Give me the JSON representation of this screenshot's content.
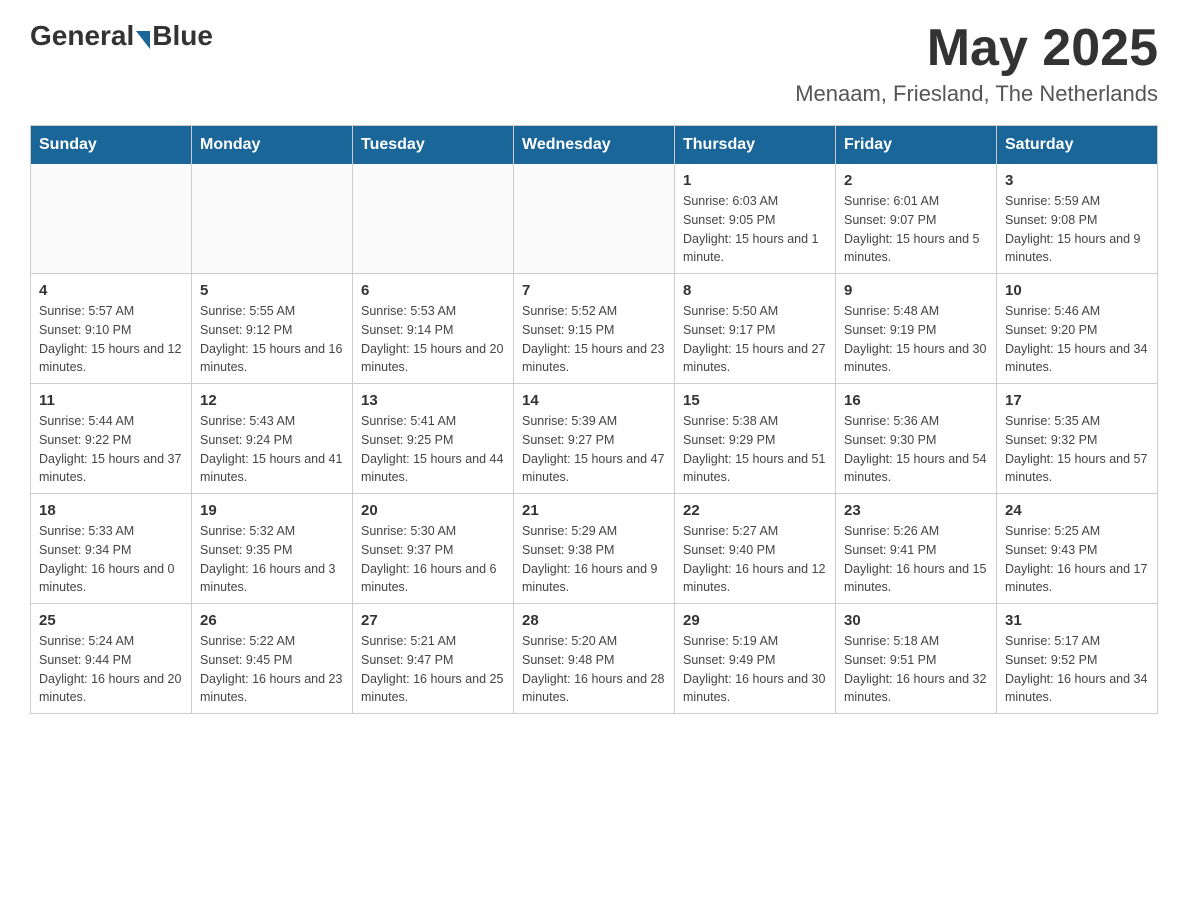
{
  "header": {
    "logo_general": "General",
    "logo_blue": "Blue",
    "month_year": "May 2025",
    "location": "Menaam, Friesland, The Netherlands"
  },
  "days_of_week": [
    "Sunday",
    "Monday",
    "Tuesday",
    "Wednesday",
    "Thursday",
    "Friday",
    "Saturday"
  ],
  "weeks": [
    [
      {
        "day": "",
        "info": ""
      },
      {
        "day": "",
        "info": ""
      },
      {
        "day": "",
        "info": ""
      },
      {
        "day": "",
        "info": ""
      },
      {
        "day": "1",
        "info": "Sunrise: 6:03 AM\nSunset: 9:05 PM\nDaylight: 15 hours and 1 minute."
      },
      {
        "day": "2",
        "info": "Sunrise: 6:01 AM\nSunset: 9:07 PM\nDaylight: 15 hours and 5 minutes."
      },
      {
        "day": "3",
        "info": "Sunrise: 5:59 AM\nSunset: 9:08 PM\nDaylight: 15 hours and 9 minutes."
      }
    ],
    [
      {
        "day": "4",
        "info": "Sunrise: 5:57 AM\nSunset: 9:10 PM\nDaylight: 15 hours and 12 minutes."
      },
      {
        "day": "5",
        "info": "Sunrise: 5:55 AM\nSunset: 9:12 PM\nDaylight: 15 hours and 16 minutes."
      },
      {
        "day": "6",
        "info": "Sunrise: 5:53 AM\nSunset: 9:14 PM\nDaylight: 15 hours and 20 minutes."
      },
      {
        "day": "7",
        "info": "Sunrise: 5:52 AM\nSunset: 9:15 PM\nDaylight: 15 hours and 23 minutes."
      },
      {
        "day": "8",
        "info": "Sunrise: 5:50 AM\nSunset: 9:17 PM\nDaylight: 15 hours and 27 minutes."
      },
      {
        "day": "9",
        "info": "Sunrise: 5:48 AM\nSunset: 9:19 PM\nDaylight: 15 hours and 30 minutes."
      },
      {
        "day": "10",
        "info": "Sunrise: 5:46 AM\nSunset: 9:20 PM\nDaylight: 15 hours and 34 minutes."
      }
    ],
    [
      {
        "day": "11",
        "info": "Sunrise: 5:44 AM\nSunset: 9:22 PM\nDaylight: 15 hours and 37 minutes."
      },
      {
        "day": "12",
        "info": "Sunrise: 5:43 AM\nSunset: 9:24 PM\nDaylight: 15 hours and 41 minutes."
      },
      {
        "day": "13",
        "info": "Sunrise: 5:41 AM\nSunset: 9:25 PM\nDaylight: 15 hours and 44 minutes."
      },
      {
        "day": "14",
        "info": "Sunrise: 5:39 AM\nSunset: 9:27 PM\nDaylight: 15 hours and 47 minutes."
      },
      {
        "day": "15",
        "info": "Sunrise: 5:38 AM\nSunset: 9:29 PM\nDaylight: 15 hours and 51 minutes."
      },
      {
        "day": "16",
        "info": "Sunrise: 5:36 AM\nSunset: 9:30 PM\nDaylight: 15 hours and 54 minutes."
      },
      {
        "day": "17",
        "info": "Sunrise: 5:35 AM\nSunset: 9:32 PM\nDaylight: 15 hours and 57 minutes."
      }
    ],
    [
      {
        "day": "18",
        "info": "Sunrise: 5:33 AM\nSunset: 9:34 PM\nDaylight: 16 hours and 0 minutes."
      },
      {
        "day": "19",
        "info": "Sunrise: 5:32 AM\nSunset: 9:35 PM\nDaylight: 16 hours and 3 minutes."
      },
      {
        "day": "20",
        "info": "Sunrise: 5:30 AM\nSunset: 9:37 PM\nDaylight: 16 hours and 6 minutes."
      },
      {
        "day": "21",
        "info": "Sunrise: 5:29 AM\nSunset: 9:38 PM\nDaylight: 16 hours and 9 minutes."
      },
      {
        "day": "22",
        "info": "Sunrise: 5:27 AM\nSunset: 9:40 PM\nDaylight: 16 hours and 12 minutes."
      },
      {
        "day": "23",
        "info": "Sunrise: 5:26 AM\nSunset: 9:41 PM\nDaylight: 16 hours and 15 minutes."
      },
      {
        "day": "24",
        "info": "Sunrise: 5:25 AM\nSunset: 9:43 PM\nDaylight: 16 hours and 17 minutes."
      }
    ],
    [
      {
        "day": "25",
        "info": "Sunrise: 5:24 AM\nSunset: 9:44 PM\nDaylight: 16 hours and 20 minutes."
      },
      {
        "day": "26",
        "info": "Sunrise: 5:22 AM\nSunset: 9:45 PM\nDaylight: 16 hours and 23 minutes."
      },
      {
        "day": "27",
        "info": "Sunrise: 5:21 AM\nSunset: 9:47 PM\nDaylight: 16 hours and 25 minutes."
      },
      {
        "day": "28",
        "info": "Sunrise: 5:20 AM\nSunset: 9:48 PM\nDaylight: 16 hours and 28 minutes."
      },
      {
        "day": "29",
        "info": "Sunrise: 5:19 AM\nSunset: 9:49 PM\nDaylight: 16 hours and 30 minutes."
      },
      {
        "day": "30",
        "info": "Sunrise: 5:18 AM\nSunset: 9:51 PM\nDaylight: 16 hours and 32 minutes."
      },
      {
        "day": "31",
        "info": "Sunrise: 5:17 AM\nSunset: 9:52 PM\nDaylight: 16 hours and 34 minutes."
      }
    ]
  ]
}
